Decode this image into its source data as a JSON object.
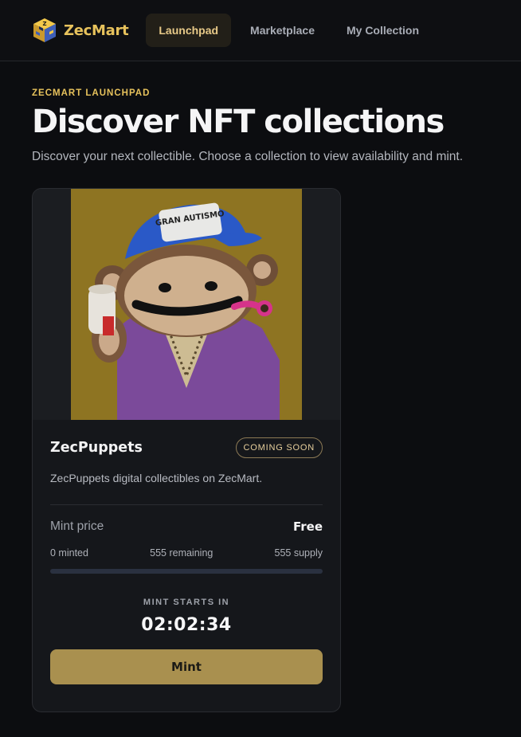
{
  "brand": {
    "name": "ZecMart",
    "icon": "zec-cube-logo-icon"
  },
  "nav": {
    "items": [
      {
        "label": "Launchpad",
        "active": true
      },
      {
        "label": "Marketplace",
        "active": false
      },
      {
        "label": "My Collection",
        "active": false
      }
    ]
  },
  "hero": {
    "eyebrow": "ZECMART LAUNCHPAD",
    "title": "Discover NFT collections",
    "subtitle": "Discover your next collectible. Choose a collection to view availability and mint."
  },
  "collection": {
    "name": "ZecPuppets",
    "badge": "COMING SOON",
    "description": "ZecPuppets digital collectibles on ZecMart.",
    "price_label": "Mint price",
    "price_value": "Free",
    "minted": "0 minted",
    "remaining": "555 remaining",
    "supply": "555 supply",
    "progress": 0,
    "mint_starts_label": "MINT STARTS IN",
    "countdown": "02:02:34",
    "mint_label": "Mint",
    "art_cap_text": "GRAN AUTISMO",
    "art": "monkey-puppet-artwork"
  },
  "colors": {
    "accent": "#e7c25c",
    "background": "#0c0d10",
    "card": "#15171b",
    "button": "#a9904f"
  }
}
